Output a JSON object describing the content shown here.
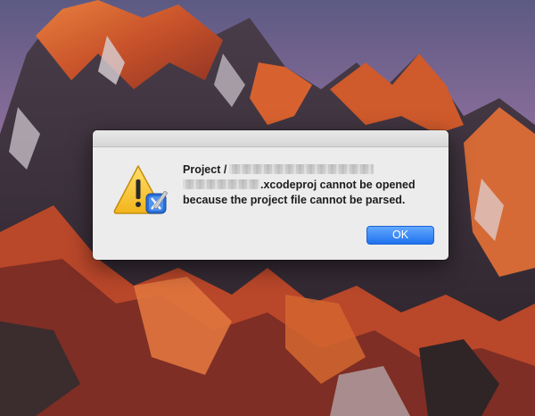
{
  "dialog": {
    "message_prefix": "Project /",
    "message_suffix": ".xcodeproj cannot be opened",
    "message_line3": "because the project file cannot be parsed.",
    "ok_label": "OK",
    "icon": "xcode-warning-icon"
  },
  "colors": {
    "accent": "#1f72ee",
    "dialog_bg": "#ececec",
    "warning_yellow": "#f6c528"
  }
}
